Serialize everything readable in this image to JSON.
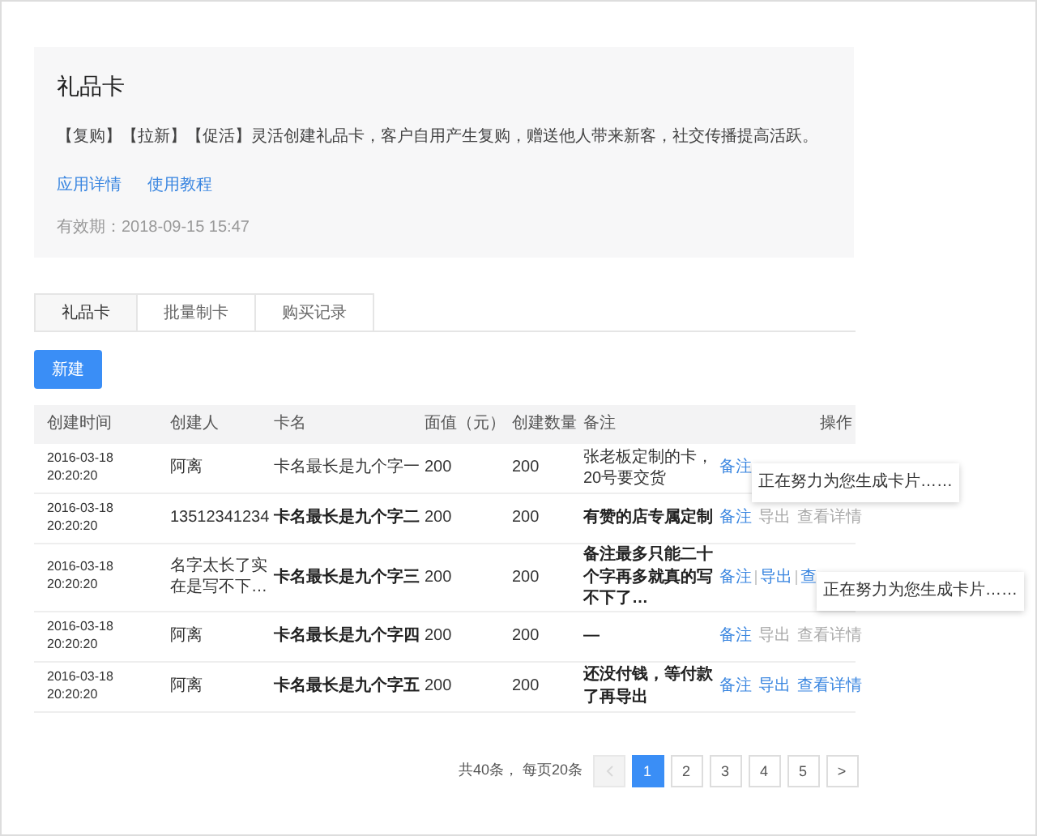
{
  "app_card": {
    "title": "礼品卡",
    "description": "【复购】【拉新】【促活】灵活创建礼品卡，客户自用产生复购，赠送他人带来新客，社交传播提高活跃。",
    "links": [
      "应用详情",
      "使用教程"
    ],
    "validity": "有效期：2018-09-15 15:47"
  },
  "tabs": [
    {
      "label": "礼品卡",
      "selected": true
    },
    {
      "label": "批量制卡",
      "selected": false
    },
    {
      "label": "购买记录",
      "selected": false
    }
  ],
  "new_button": "新建",
  "table": {
    "columns": [
      "创建时间",
      "创建人",
      "卡名",
      "面值（元）",
      "创建数量",
      "备注",
      "操作"
    ],
    "rows": [
      {
        "time": "2016-03-18 20:20:20",
        "creator": "阿离",
        "name": "卡名最长是九个字一",
        "value": "200",
        "count": "200",
        "note": "张老板定制的卡，20号要交货",
        "bold": false,
        "actions": [
          {
            "label": "备注",
            "disabled": false
          }
        ],
        "tooltip": "正在努力为您生成卡片……"
      },
      {
        "time": "2016-03-18 20:20:20",
        "creator": "13512341234",
        "name": "卡名最长是九个字二",
        "value": "200",
        "count": "200",
        "note": "有赞的店专属定制",
        "bold": true,
        "actions": [
          {
            "label": "备注",
            "disabled": false
          },
          {
            "label": "导出",
            "disabled": true
          },
          {
            "label": "查看详情",
            "disabled": true
          }
        ]
      },
      {
        "time": "2016-03-18 20:20:20",
        "creator": "名字太长了实在是写不下…",
        "name": "卡名最长是九个字三",
        "value": "200",
        "count": "200",
        "note": "备注最多只能二十个字再多就真的写不下了…",
        "bold": true,
        "actions": [
          {
            "label": "备注",
            "disabled": false
          },
          {
            "label": "导出",
            "disabled": false
          },
          {
            "label": "查",
            "disabled": false
          }
        ],
        "tooltip": "正在努力为您生成卡片……"
      },
      {
        "time": "2016-03-18 20:20:20",
        "creator": "阿离",
        "name": "卡名最长是九个字四",
        "value": "200",
        "count": "200",
        "note": "—",
        "bold": true,
        "actions": [
          {
            "label": "备注",
            "disabled": false
          },
          {
            "label": "导出",
            "disabled": true
          },
          {
            "label": "查看详情",
            "disabled": true
          }
        ]
      },
      {
        "time": "2016-03-18 20:20:20",
        "creator": "阿离",
        "name": "卡名最长是九个字五",
        "value": "200",
        "count": "200",
        "note": "还没付钱，等付款了再导出",
        "bold": true,
        "actions": [
          {
            "label": "备注",
            "disabled": false
          },
          {
            "label": "导出",
            "disabled": false
          },
          {
            "label": "查看详情",
            "disabled": false
          }
        ]
      }
    ]
  },
  "pagination": {
    "summary": "共40条， 每页20条",
    "prev_disabled": true,
    "pages": [
      {
        "label": "1",
        "selected": true
      },
      {
        "label": "2",
        "selected": false
      },
      {
        "label": "3",
        "selected": false
      },
      {
        "label": "4",
        "selected": false
      },
      {
        "label": "5",
        "selected": false
      }
    ],
    "next": ">"
  }
}
